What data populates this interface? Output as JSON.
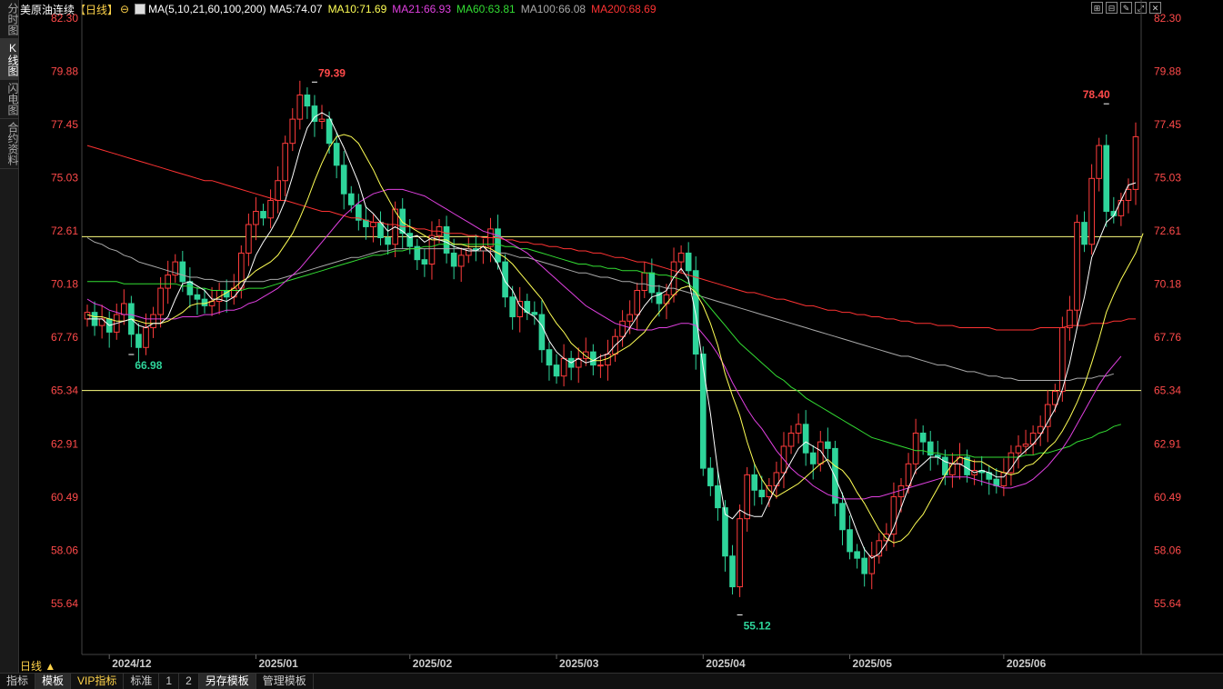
{
  "left_tabs": [
    {
      "label": "分时图",
      "active": false
    },
    {
      "label": "K线图",
      "active": true
    },
    {
      "label": "闪电图",
      "active": false
    },
    {
      "label": "合约资料",
      "active": false
    }
  ],
  "header": {
    "symbol": "美原油连续",
    "period_tag": "【日线】",
    "ma_params": "MA(5,10,21,60,100,200)",
    "ma5": "MA5:74.07",
    "ma10": "MA10:71.69",
    "ma21": "MA21:66.93",
    "ma60": "MA60:63.81",
    "ma100": "MA100:66.08",
    "ma200": "MA200:68.69"
  },
  "colors": {
    "up": "#ff3c3c",
    "down": "#2ed49a",
    "ma5": "#ffffff",
    "ma10": "#ffff55",
    "ma21": "#e040e0",
    "ma60": "#33dd33",
    "ma100": "#aaaaaa",
    "ma200": "#ff3333",
    "axis_text": "#ff4a4a",
    "hline": "#ffff80"
  },
  "window_buttons": [
    "grid-icon",
    "grid2-icon",
    "edit-icon",
    "expand-icon",
    "close-icon"
  ],
  "period_label": "日线 ▲",
  "bottom_tabs": [
    {
      "label": "指标",
      "active": false
    },
    {
      "label": "模板",
      "active": true
    },
    {
      "label": "VIP指标",
      "active": false
    },
    {
      "label": "标准",
      "active": false
    },
    {
      "label": "1",
      "active": false
    },
    {
      "label": "2",
      "active": false
    },
    {
      "label": "另存模板",
      "active": true
    },
    {
      "label": "管理模板",
      "active": false
    }
  ],
  "chart_data": {
    "type": "candlestick",
    "y_ticks": [
      82.3,
      79.88,
      77.45,
      75.03,
      72.61,
      70.18,
      67.76,
      65.34,
      62.91,
      60.49,
      58.06,
      55.64
    ],
    "y_tick_labels": [
      "82.30",
      "79.88",
      "77.45",
      "75.03",
      "72.61",
      "70.18",
      "67.76",
      "65.34",
      "62.91",
      "60.49",
      "58.06",
      "55.64"
    ],
    "ylim": [
      53.4,
      82.3
    ],
    "x_ticks": [
      {
        "label": "2024/12",
        "index": 3
      },
      {
        "label": "2025/01",
        "index": 23
      },
      {
        "label": "2025/02",
        "index": 44
      },
      {
        "label": "2025/03",
        "index": 64
      },
      {
        "label": "2025/04",
        "index": 84
      },
      {
        "label": "2025/05",
        "index": 104
      },
      {
        "label": "2025/06",
        "index": 125
      }
    ],
    "hlines": [
      72.35,
      65.34
    ],
    "annotations": [
      {
        "text": "79.39",
        "index": 31,
        "value": 79.39,
        "color": "#ff4a4a"
      },
      {
        "text": "66.98",
        "index": 6,
        "value": 66.98,
        "color": "#2ed49a"
      },
      {
        "text": "55.12",
        "index": 89,
        "value": 55.12,
        "color": "#2ed49a"
      },
      {
        "text": "78.40",
        "index": 139,
        "value": 78.4,
        "color": "#ff4a4a"
      }
    ],
    "closes": [
      68.9,
      68.3,
      68.6,
      68.0,
      68.8,
      69.3,
      67.9,
      67.3,
      68.2,
      68.8,
      70.0,
      70.6,
      71.2,
      70.3,
      69.7,
      69.5,
      69.2,
      69.4,
      69.9,
      69.6,
      70.0,
      71.6,
      72.9,
      73.5,
      73.2,
      74.0,
      74.9,
      76.6,
      77.7,
      78.8,
      78.3,
      77.6,
      77.7,
      76.6,
      75.6,
      74.3,
      73.8,
      73.1,
      72.8,
      73.0,
      72.3,
      72.0,
      73.6,
      72.5,
      71.9,
      71.3,
      71.1,
      72.4,
      72.8,
      71.6,
      71.0,
      71.5,
      71.8,
      71.7,
      71.9,
      72.7,
      71.2,
      69.6,
      68.7,
      69.4,
      68.9,
      68.8,
      67.2,
      66.5,
      66.0,
      66.8,
      66.4,
      66.8,
      67.1,
      66.5,
      66.5,
      67.0,
      67.8,
      68.5,
      68.8,
      69.9,
      70.7,
      69.8,
      69.3,
      69.7,
      71.2,
      71.6,
      70.8,
      67.0,
      61.8,
      61.0,
      60.0,
      57.8,
      56.4,
      59.5,
      61.5,
      60.8,
      60.5,
      61.0,
      61.6,
      62.8,
      63.4,
      63.8,
      62.5,
      62.0,
      63.0,
      62.7,
      60.2,
      59.0,
      58.0,
      57.7,
      57.0,
      57.8,
      58.5,
      58.8,
      60.5,
      61.0,
      62.0,
      63.4,
      63.0,
      62.4,
      62.3,
      61.5,
      62.0,
      62.3,
      61.5,
      61.7,
      61.6,
      61.3,
      61.0,
      61.6,
      62.5,
      62.8,
      62.9,
      63.4,
      63.7,
      64.7,
      65.3,
      68.2,
      69.0,
      73.0,
      72.0,
      75.0,
      76.5,
      73.5,
      73.3,
      74.0,
      74.5,
      76.9
    ],
    "ma5": [
      68.6,
      68.6,
      68.6,
      68.3,
      68.4,
      68.5,
      68.6,
      68.3,
      68.2,
      68.4,
      68.4,
      68.7,
      69.5,
      70.2,
      70.3,
      70.1,
      69.9,
      69.5,
      69.5,
      69.4,
      69.6,
      70.0,
      70.6,
      71.5,
      72.1,
      72.6,
      73.2,
      74.0,
      75.1,
      76.3,
      77.3,
      77.8,
      78.0,
      77.8,
      77.1,
      76.4,
      75.6,
      74.8,
      73.7,
      73.4,
      73.0,
      72.6,
      72.8,
      72.6,
      72.3,
      72.4,
      72.1,
      72.3,
      72.2,
      72.1,
      71.9,
      71.8,
      71.7,
      71.7,
      71.9,
      71.6,
      71.1,
      70.3,
      69.9,
      69.2,
      68.9,
      68.7,
      68.3,
      67.6,
      67.1,
      66.8,
      66.6,
      66.8,
      66.6,
      66.7,
      66.9,
      67.0,
      67.4,
      67.7,
      68.2,
      68.7,
      69.2,
      69.6,
      69.7,
      69.9,
      70.5,
      70.9,
      70.4,
      68.8,
      66.4,
      64.3,
      61.7,
      59.7,
      59.5,
      59.9,
      59.7,
      59.6,
      59.6,
      60.3,
      61.0,
      61.5,
      62.1,
      62.7,
      63.0,
      62.8,
      62.6,
      62.1,
      61.4,
      60.6,
      59.8,
      58.9,
      58.1,
      57.7,
      57.9,
      58.4,
      59.1,
      60.0,
      60.9,
      61.7,
      62.0,
      62.3,
      62.3,
      62.1,
      62.0,
      62.0,
      61.8,
      61.6,
      61.7,
      61.6,
      61.4,
      61.4,
      61.8,
      62.3,
      62.6,
      62.9,
      63.3,
      63.9,
      64.5,
      65.4,
      66.6,
      68.2,
      69.6,
      71.4,
      72.2,
      73.0,
      73.3,
      74.0,
      74.7,
      74.8
    ],
    "ma10": [
      68.8,
      68.7,
      68.7,
      68.6,
      68.5,
      68.5,
      68.6,
      68.5,
      68.4,
      68.4,
      68.4,
      68.5,
      68.7,
      68.9,
      69.2,
      69.3,
      69.3,
      69.4,
      69.6,
      69.8,
      70.0,
      70.3,
      70.5,
      70.8,
      71.0,
      71.2,
      71.5,
      72.0,
      72.5,
      73.2,
      74.0,
      74.9,
      75.7,
      76.4,
      76.9,
      77.0,
      76.9,
      76.6,
      76.0,
      75.4,
      74.7,
      74.1,
      73.5,
      73.0,
      72.8,
      72.6,
      72.4,
      72.2,
      72.2,
      72.2,
      72.0,
      72.0,
      71.9,
      71.9,
      71.9,
      71.8,
      71.6,
      71.4,
      71.1,
      70.7,
      70.3,
      69.9,
      69.5,
      68.9,
      68.4,
      68.0,
      67.5,
      67.2,
      66.9,
      66.7,
      66.7,
      66.8,
      67.0,
      67.2,
      67.4,
      67.7,
      68.0,
      68.5,
      68.9,
      69.3,
      69.7,
      70.0,
      70.1,
      69.8,
      69.2,
      68.4,
      67.4,
      66.1,
      65.1,
      64.2,
      63.0,
      62.0,
      61.3,
      60.8,
      60.5,
      60.7,
      60.9,
      61.1,
      61.4,
      61.7,
      62.0,
      62.2,
      61.9,
      61.7,
      61.3,
      60.7,
      60.2,
      59.6,
      59.0,
      58.6,
      58.4,
      58.5,
      58.8,
      59.3,
      59.7,
      60.3,
      60.9,
      61.5,
      62.0,
      62.3,
      62.2,
      62.1,
      62.1,
      61.9,
      61.7,
      61.6,
      61.5,
      61.6,
      61.9,
      62.0,
      62.3,
      62.7,
      63.0,
      63.5,
      64.1,
      64.8,
      65.6,
      66.6,
      67.7,
      68.9,
      69.7,
      70.4,
      71.0,
      71.6,
      72.5
    ],
    "ma21": [
      69.5,
      69.3,
      69.2,
      69.0,
      68.9,
      68.8,
      68.8,
      68.7,
      68.6,
      68.6,
      68.6,
      68.6,
      68.6,
      68.7,
      68.7,
      68.7,
      68.8,
      68.8,
      68.9,
      69.0,
      69.0,
      69.1,
      69.3,
      69.4,
      69.6,
      69.8,
      70.0,
      70.3,
      70.6,
      70.9,
      71.3,
      71.7,
      72.1,
      72.5,
      72.9,
      73.3,
      73.6,
      73.9,
      74.1,
      74.3,
      74.4,
      74.5,
      74.5,
      74.5,
      74.4,
      74.3,
      74.2,
      74.0,
      73.8,
      73.6,
      73.4,
      73.2,
      73.0,
      72.8,
      72.6,
      72.5,
      72.4,
      72.2,
      72.0,
      71.8,
      71.6,
      71.3,
      71.0,
      70.7,
      70.4,
      70.1,
      69.8,
      69.5,
      69.2,
      69.0,
      68.8,
      68.6,
      68.4,
      68.3,
      68.2,
      68.1,
      68.1,
      68.1,
      68.2,
      68.2,
      68.3,
      68.4,
      68.4,
      68.3,
      67.9,
      67.5,
      67.0,
      66.4,
      65.7,
      65.1,
      64.5,
      64.0,
      63.6,
      63.1,
      62.6,
      62.2,
      61.8,
      61.5,
      61.3,
      61.0,
      60.8,
      60.6,
      60.5,
      60.4,
      60.4,
      60.4,
      60.4,
      60.5,
      60.5,
      60.6,
      60.7,
      60.8,
      60.9,
      61.0,
      61.1,
      61.2,
      61.3,
      61.4,
      61.4,
      61.4,
      61.4,
      61.3,
      61.2,
      61.1,
      61.0,
      60.9,
      60.9,
      61.0,
      61.1,
      61.3,
      61.6,
      61.9,
      62.3,
      62.7,
      63.2,
      63.8,
      64.4,
      65.0,
      65.6,
      66.1,
      66.5,
      66.9
    ],
    "ma60": [
      70.3,
      70.3,
      70.3,
      70.3,
      70.3,
      70.2,
      70.2,
      70.2,
      70.2,
      70.2,
      70.2,
      70.2,
      70.2,
      70.1,
      70.1,
      70.0,
      70.0,
      69.9,
      69.9,
      69.9,
      69.9,
      69.9,
      70.0,
      70.0,
      70.0,
      70.1,
      70.2,
      70.3,
      70.4,
      70.5,
      70.6,
      70.7,
      70.8,
      70.9,
      71.0,
      71.1,
      71.2,
      71.3,
      71.4,
      71.5,
      71.5,
      71.6,
      71.7,
      71.7,
      71.8,
      71.8,
      71.9,
      71.9,
      72.0,
      72.0,
      72.0,
      72.0,
      72.0,
      72.0,
      72.0,
      72.0,
      72.0,
      71.9,
      71.9,
      71.8,
      71.8,
      71.7,
      71.6,
      71.5,
      71.4,
      71.3,
      71.2,
      71.1,
      71.1,
      71.0,
      71.0,
      70.9,
      70.9,
      70.8,
      70.8,
      70.8,
      70.7,
      70.7,
      70.6,
      70.6,
      70.5,
      70.4,
      70.2,
      69.9,
      69.5,
      69.1,
      68.7,
      68.3,
      67.9,
      67.5,
      67.2,
      66.9,
      66.6,
      66.3,
      66.0,
      65.8,
      65.5,
      65.3,
      65.0,
      64.8,
      64.6,
      64.4,
      64.2,
      64.0,
      63.8,
      63.6,
      63.4,
      63.2,
      63.1,
      63.0,
      62.9,
      62.8,
      62.7,
      62.6,
      62.6,
      62.5,
      62.5,
      62.4,
      62.4,
      62.4,
      62.4,
      62.3,
      62.3,
      62.3,
      62.3,
      62.3,
      62.3,
      62.3,
      62.4,
      62.4,
      62.5,
      62.5,
      62.6,
      62.7,
      62.8,
      63.0,
      63.1,
      63.2,
      63.4,
      63.5,
      63.7,
      63.8
    ],
    "ma100": [
      72.3,
      72.1,
      72.0,
      71.8,
      71.7,
      71.5,
      71.4,
      71.2,
      71.1,
      71.0,
      70.9,
      70.8,
      70.7,
      70.6,
      70.5,
      70.5,
      70.4,
      70.4,
      70.3,
      70.3,
      70.3,
      70.3,
      70.3,
      70.3,
      70.3,
      70.4,
      70.4,
      70.5,
      70.6,
      70.7,
      70.8,
      70.9,
      71.0,
      71.1,
      71.2,
      71.3,
      71.4,
      71.4,
      71.5,
      71.6,
      71.7,
      71.7,
      71.8,
      71.8,
      71.8,
      71.8,
      71.8,
      71.8,
      71.8,
      71.8,
      71.8,
      71.8,
      71.8,
      71.7,
      71.7,
      71.7,
      71.6,
      71.6,
      71.5,
      71.4,
      71.4,
      71.3,
      71.2,
      71.1,
      71.0,
      70.9,
      70.8,
      70.7,
      70.7,
      70.6,
      70.5,
      70.5,
      70.4,
      70.3,
      70.3,
      70.2,
      70.2,
      70.1,
      70.1,
      70.0,
      70.0,
      69.9,
      69.8,
      69.7,
      69.6,
      69.5,
      69.4,
      69.3,
      69.2,
      69.1,
      69.0,
      68.9,
      68.8,
      68.7,
      68.6,
      68.5,
      68.4,
      68.3,
      68.2,
      68.1,
      68.0,
      67.9,
      67.8,
      67.7,
      67.6,
      67.5,
      67.4,
      67.3,
      67.2,
      67.1,
      67.0,
      66.9,
      66.9,
      66.8,
      66.7,
      66.6,
      66.5,
      66.5,
      66.4,
      66.3,
      66.2,
      66.2,
      66.1,
      66.0,
      66.0,
      65.9,
      65.9,
      65.8,
      65.8,
      65.8,
      65.8,
      65.8,
      65.8,
      65.8,
      65.8,
      65.9,
      65.9,
      65.9,
      66.0,
      66.0,
      66.1
    ],
    "ma200": [
      76.5,
      76.4,
      76.3,
      76.2,
      76.1,
      76.0,
      75.9,
      75.8,
      75.7,
      75.6,
      75.5,
      75.4,
      75.3,
      75.2,
      75.1,
      75.0,
      74.9,
      74.9,
      74.8,
      74.7,
      74.6,
      74.5,
      74.4,
      74.3,
      74.2,
      74.1,
      74.0,
      74.0,
      73.9,
      73.8,
      73.7,
      73.6,
      73.5,
      73.5,
      73.4,
      73.3,
      73.2,
      73.2,
      73.1,
      73.0,
      73.0,
      72.9,
      72.9,
      72.8,
      72.8,
      72.7,
      72.7,
      72.6,
      72.6,
      72.5,
      72.5,
      72.5,
      72.4,
      72.4,
      72.3,
      72.3,
      72.3,
      72.2,
      72.2,
      72.1,
      72.1,
      72.0,
      72.0,
      71.9,
      71.9,
      71.8,
      71.8,
      71.7,
      71.7,
      71.6,
      71.6,
      71.5,
      71.4,
      71.4,
      71.3,
      71.2,
      71.2,
      71.1,
      71.0,
      70.9,
      70.8,
      70.7,
      70.6,
      70.5,
      70.4,
      70.3,
      70.2,
      70.1,
      70.0,
      69.9,
      69.8,
      69.8,
      69.7,
      69.6,
      69.5,
      69.5,
      69.4,
      69.3,
      69.2,
      69.2,
      69.1,
      69.0,
      69.0,
      68.9,
      68.9,
      68.8,
      68.8,
      68.7,
      68.7,
      68.6,
      68.6,
      68.5,
      68.5,
      68.4,
      68.4,
      68.4,
      68.3,
      68.3,
      68.3,
      68.2,
      68.2,
      68.2,
      68.2,
      68.2,
      68.1,
      68.1,
      68.1,
      68.1,
      68.1,
      68.1,
      68.2,
      68.2,
      68.2,
      68.2,
      68.3,
      68.3,
      68.3,
      68.4,
      68.4,
      68.4,
      68.5,
      68.5,
      68.6,
      68.6
    ]
  }
}
